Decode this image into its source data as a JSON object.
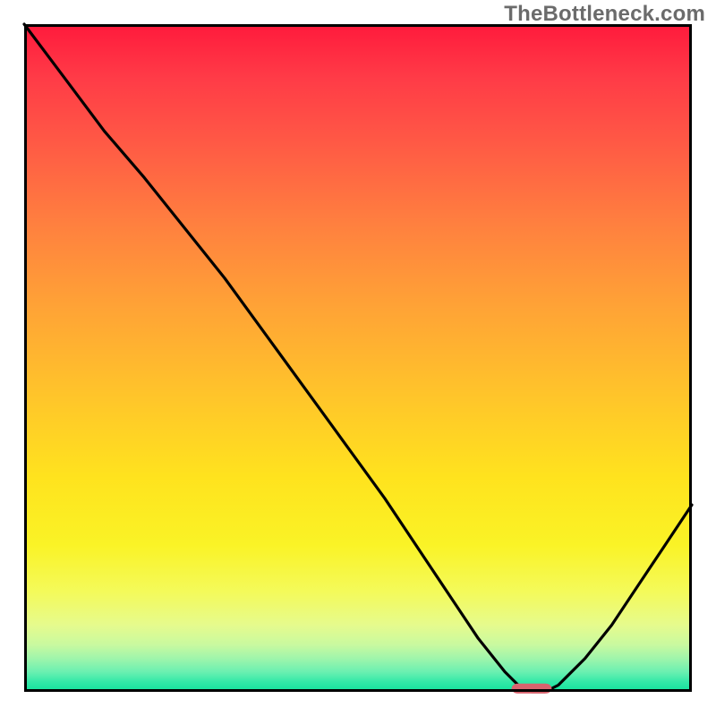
{
  "watermark": "TheBottleneck.com",
  "chart_data": {
    "type": "line",
    "title": "",
    "xlabel": "",
    "ylabel": "",
    "xlim": [
      0,
      100
    ],
    "ylim": [
      0,
      100
    ],
    "grid": false,
    "background": "vertical-gradient-red-to-green",
    "series": [
      {
        "name": "bottleneck-curve",
        "color": "#000000",
        "x": [
          0,
          6,
          12,
          18,
          22,
          26,
          30,
          38,
          46,
          54,
          62,
          68,
          72,
          74,
          76,
          78,
          80,
          84,
          88,
          92,
          96,
          100
        ],
        "y": [
          100,
          92,
          84,
          77,
          72,
          67,
          62,
          51,
          40,
          29,
          17,
          8,
          3,
          1,
          0,
          0,
          1,
          5,
          10,
          16,
          22,
          28
        ]
      }
    ],
    "marker": {
      "name": "target-marker",
      "shape": "rounded-rect",
      "color": "#d9636e",
      "x_center": 76,
      "y_center": 0.5,
      "width_x": 6,
      "height_y": 1.5
    }
  }
}
